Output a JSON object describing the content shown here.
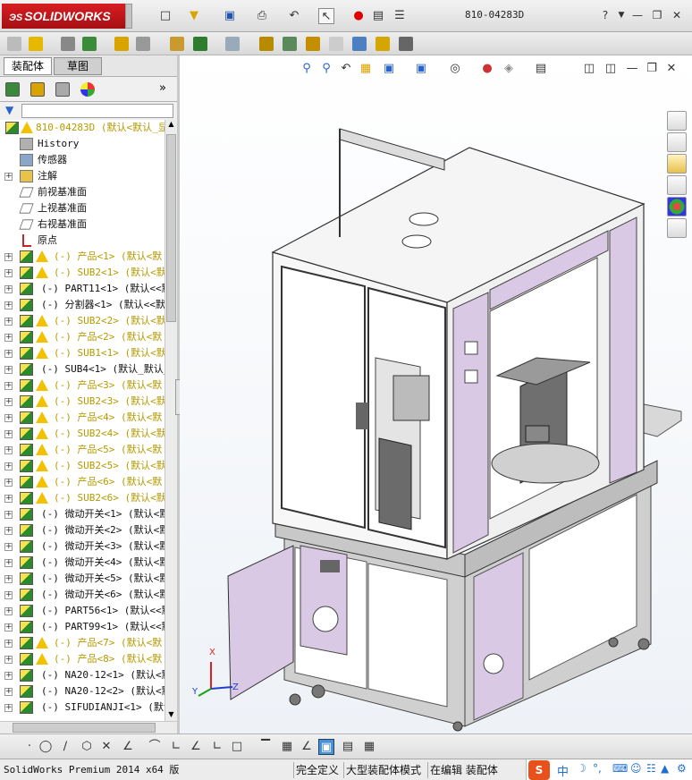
{
  "app": {
    "logo_text": "SOLIDWORKS",
    "document_title": "810-04283D"
  },
  "left_panel": {
    "tabs": [
      {
        "label": "装配体",
        "active": true
      },
      {
        "label": "草图",
        "active": false
      }
    ]
  },
  "tree": {
    "root": "810-04283D  (默认<默认_显",
    "items": [
      {
        "label": "History",
        "icon": "history-icon",
        "warn": false,
        "expand": false,
        "indent": 1
      },
      {
        "label": "传感器",
        "icon": "sensor-icon",
        "warn": false,
        "expand": false,
        "indent": 1
      },
      {
        "label": "注解",
        "icon": "annotation-icon",
        "warn": false,
        "expand": true,
        "indent": 1
      },
      {
        "label": "前视基准面",
        "icon": "plane-icon",
        "warn": false,
        "expand": false,
        "indent": 1
      },
      {
        "label": "上视基准面",
        "icon": "plane-icon",
        "warn": false,
        "expand": false,
        "indent": 1
      },
      {
        "label": "右视基准面",
        "icon": "plane-icon",
        "warn": false,
        "expand": false,
        "indent": 1
      },
      {
        "label": "原点",
        "icon": "origin-icon",
        "warn": false,
        "expand": false,
        "indent": 1
      },
      {
        "label": "(-) 产品<1> (默认<默",
        "icon": "assembly-icon",
        "warn": true,
        "expand": true
      },
      {
        "label": "(-) SUB2<1> (默认<默",
        "icon": "assembly-icon",
        "warn": true,
        "expand": true
      },
      {
        "label": "(-) PART11<1> (默认<<默",
        "icon": "assembly-icon",
        "warn": false,
        "expand": true
      },
      {
        "label": "(-) 分割器<1> (默认<<默",
        "icon": "assembly-icon",
        "warn": false,
        "expand": true
      },
      {
        "label": "(-) SUB2<2> (默认<默",
        "icon": "assembly-icon",
        "warn": true,
        "expand": true
      },
      {
        "label": "(-) 产品<2> (默认<默",
        "icon": "assembly-icon",
        "warn": true,
        "expand": true
      },
      {
        "label": "(-) SUB1<1> (默认<默",
        "icon": "assembly-icon",
        "warn": true,
        "expand": true
      },
      {
        "label": "(-) SUB4<1> (默认_默认_",
        "icon": "assembly-icon",
        "warn": false,
        "expand": true
      },
      {
        "label": "(-) 产品<3> (默认<默",
        "icon": "assembly-icon",
        "warn": true,
        "expand": true
      },
      {
        "label": "(-) SUB2<3> (默认<默",
        "icon": "assembly-icon",
        "warn": true,
        "expand": true
      },
      {
        "label": "(-) 产品<4> (默认<默",
        "icon": "assembly-icon",
        "warn": true,
        "expand": true
      },
      {
        "label": "(-) SUB2<4> (默认<默",
        "icon": "assembly-icon",
        "warn": true,
        "expand": true
      },
      {
        "label": "(-) 产品<5> (默认<默",
        "icon": "assembly-icon",
        "warn": true,
        "expand": true
      },
      {
        "label": "(-) SUB2<5> (默认<默",
        "icon": "assembly-icon",
        "warn": true,
        "expand": true
      },
      {
        "label": "(-) 产品<6> (默认<默",
        "icon": "assembly-icon",
        "warn": true,
        "expand": true
      },
      {
        "label": "(-) SUB2<6> (默认<默",
        "icon": "assembly-icon",
        "warn": true,
        "expand": true
      },
      {
        "label": "(-) 微动开关<1> (默认<默",
        "icon": "assembly-icon",
        "warn": false,
        "expand": true
      },
      {
        "label": "(-) 微动开关<2> (默认<默",
        "icon": "assembly-icon",
        "warn": false,
        "expand": true
      },
      {
        "label": "(-) 微动开关<3> (默认<默",
        "icon": "assembly-icon",
        "warn": false,
        "expand": true
      },
      {
        "label": "(-) 微动开关<4> (默认<默",
        "icon": "assembly-icon",
        "warn": false,
        "expand": true
      },
      {
        "label": "(-) 微动开关<5> (默认<默",
        "icon": "assembly-icon",
        "warn": false,
        "expand": true
      },
      {
        "label": "(-) 微动开关<6> (默认<默",
        "icon": "assembly-icon",
        "warn": false,
        "expand": true
      },
      {
        "label": "(-) PART56<1> (默认<<默",
        "icon": "assembly-icon",
        "warn": false,
        "expand": true
      },
      {
        "label": "(-) PART99<1> (默认<<默",
        "icon": "assembly-icon",
        "warn": false,
        "expand": true
      },
      {
        "label": "(-) 产品<7> (默认<默",
        "icon": "assembly-icon",
        "warn": true,
        "expand": true
      },
      {
        "label": "(-) 产品<8> (默认<默",
        "icon": "assembly-icon",
        "warn": true,
        "expand": true
      },
      {
        "label": "(-) NA20-12<1> (默认<默",
        "icon": "assembly-icon",
        "warn": false,
        "expand": true
      },
      {
        "label": "(-) NA20-12<2> (默认<默",
        "icon": "assembly-icon",
        "warn": false,
        "expand": true
      },
      {
        "label": "(-) SIFUDIANJI<1> (默认<",
        "icon": "assembly-icon",
        "warn": false,
        "expand": true
      }
    ]
  },
  "statusbar": {
    "product": "SolidWorks Premium 2014 x64 版",
    "state1": "完全定义",
    "state2": "大型装配体模式",
    "state3": "在编辑 装配体"
  },
  "ime": {
    "lang": "中"
  },
  "triad": {
    "x": "X",
    "y": "Y",
    "z": "Z"
  },
  "colors": {
    "panel_purple": "#d9c9e4",
    "frame_gray": "#c8c8c8",
    "warn_yellow": "#b59a00",
    "logo_red": "#c4161c"
  }
}
